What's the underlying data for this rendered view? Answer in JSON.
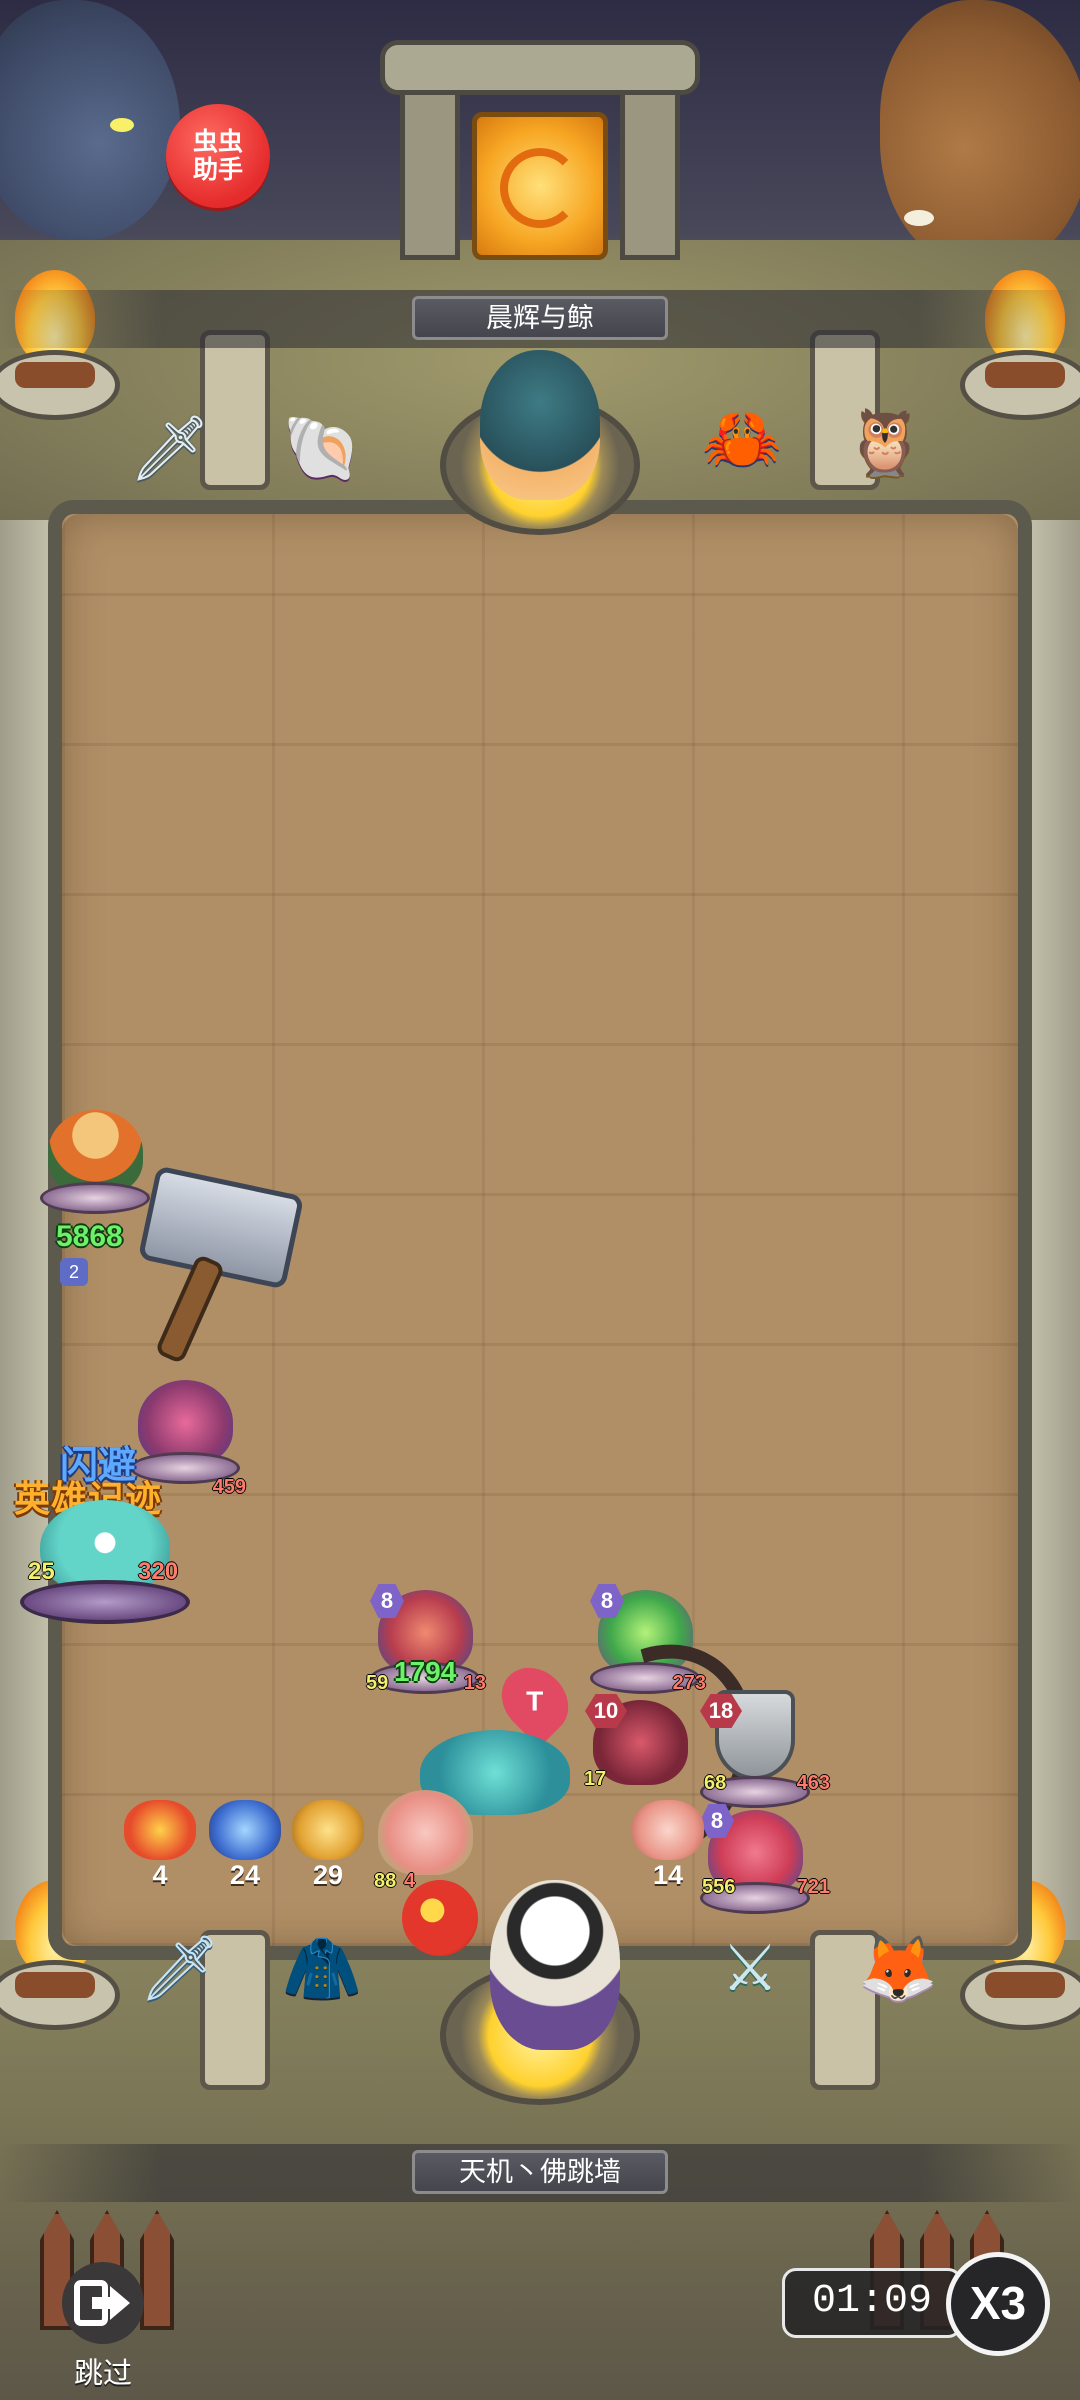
{
  "badge": {
    "label": "虫虫\n助手"
  },
  "opponent": {
    "name": "晨辉与鲸"
  },
  "player": {
    "name": "天机丶佛跳墙"
  },
  "combat_text": {
    "dodge": "闪避",
    "hero_record": "英雄记迹"
  },
  "units": {
    "king_hero": {
      "hp": "5868",
      "level": "2"
    },
    "left_stack": {
      "hp": "459"
    },
    "left_boss": {
      "atk": "25",
      "hp": "320"
    },
    "center_left": {
      "level": "8",
      "atk": "59",
      "hp_big": "1794",
      "hp": "13"
    },
    "center_right": {
      "level": "8",
      "hp": "273"
    },
    "red_unit": {
      "level": "10"
    },
    "shield_unit": {
      "level": "18",
      "atk": "68",
      "hp": "463"
    },
    "mid_unit": {
      "atk": "17"
    },
    "pig_unit": {
      "atk": "88",
      "hp": "4"
    },
    "bottom_right": {
      "level": "8",
      "atk": "556",
      "hp": "721"
    }
  },
  "hand_cards": [
    {
      "icon": "lion-dance-icon",
      "count": "4"
    },
    {
      "icon": "blue-monster-icon",
      "count": "24"
    },
    {
      "icon": "golden-frog-icon",
      "count": "29"
    },
    {
      "icon": "pig-icon",
      "count": "14"
    }
  ],
  "equipment": {
    "top": [
      "jade-dagger-icon",
      "pink-shell-icon",
      "blue-crab-icon",
      "owl-icon"
    ],
    "bottom": [
      "ice-sword-icon",
      "dark-coat-icon",
      "teal-sword-icon",
      "white-fox-icon"
    ]
  },
  "hud": {
    "skip_label": "跳过",
    "timer": "01:09",
    "speed": "X3"
  },
  "colors": {
    "arena": "#b08f66",
    "badge": "#e52b2b",
    "flame": "#ffc93b"
  }
}
